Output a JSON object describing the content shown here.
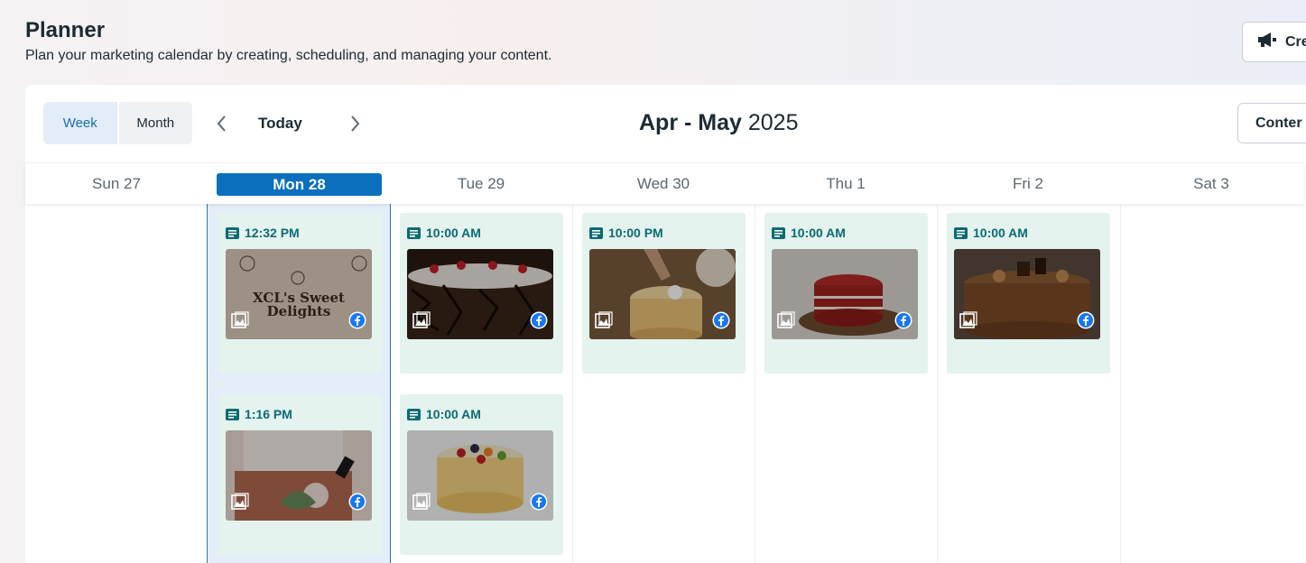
{
  "header": {
    "title": "Planner",
    "subtitle": "Plan your marketing calendar by creating, scheduling, and managing your content.",
    "create_label": "Cre"
  },
  "toolbar": {
    "view_week": "Week",
    "view_month": "Month",
    "active_view": "Week",
    "today_label": "Today",
    "range_bold": "Apr - May",
    "range_year": "2025",
    "content_label": "Conter"
  },
  "days": [
    {
      "label": "Sun 27",
      "today": false
    },
    {
      "label": "Mon 28",
      "today": true
    },
    {
      "label": "Tue 29",
      "today": false
    },
    {
      "label": "Wed 30",
      "today": false
    },
    {
      "label": "Thu 1",
      "today": false
    },
    {
      "label": "Fri 2",
      "today": false
    },
    {
      "label": "Sat 3",
      "today": false
    }
  ],
  "posts": [
    {
      "day": "Mon 28",
      "time": "12:32 PM",
      "platform": "facebook-icon",
      "media": "photo-icon",
      "thumb_text": [
        "XCL's Sweet",
        "Delights"
      ]
    },
    {
      "day": "Tue 29",
      "time": "10:00 AM",
      "platform": "facebook-icon",
      "media": "photo-icon"
    },
    {
      "day": "Wed 30",
      "time": "10:00 PM",
      "platform": "facebook-icon",
      "media": "photo-icon"
    },
    {
      "day": "Thu 1",
      "time": "10:00 AM",
      "platform": "facebook-icon",
      "media": "photo-icon"
    },
    {
      "day": "Fri 2",
      "time": "10:00 AM",
      "platform": "facebook-icon",
      "media": "photo-icon"
    },
    {
      "day": "Mon 28",
      "time": "1:16 PM",
      "platform": "facebook-icon",
      "media": "photo-icon"
    },
    {
      "day": "Tue 29",
      "time": "10:00 AM",
      "platform": "facebook-icon",
      "media": "photo-icon"
    }
  ],
  "colors": {
    "accent": "#0a6fbc",
    "post_bg": "#e4f3ee",
    "post_time": "#0b6b74",
    "facebook": "#1877f2"
  }
}
